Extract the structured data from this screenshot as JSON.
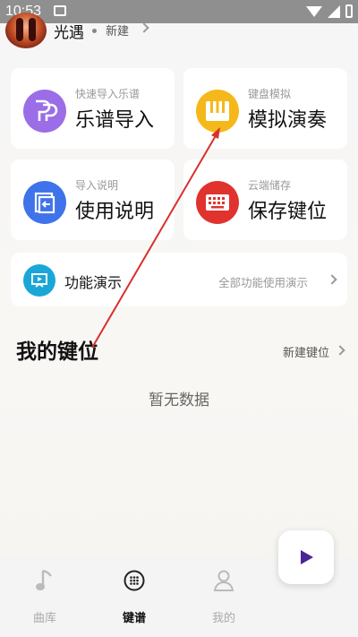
{
  "status_bar": {
    "time": "10:53"
  },
  "header": {
    "app_name": "光遇",
    "new_label": "新建"
  },
  "cards": [
    {
      "subtitle": "快速导入乐谱",
      "title": "乐谱导入",
      "color": "#9b6de6",
      "icon": "import-score-icon"
    },
    {
      "subtitle": "键盘模拟",
      "title": "模拟演奏",
      "color": "#f5b81b",
      "icon": "piano-icon"
    },
    {
      "subtitle": "导入说明",
      "title": "使用说明",
      "color": "#3f73ea",
      "icon": "instructions-icon"
    },
    {
      "subtitle": "云端储存",
      "title": "保存键位",
      "color": "#e0332e",
      "icon": "keyboard-icon"
    }
  ],
  "demo": {
    "title": "功能演示",
    "link": "全部功能使用演示"
  },
  "my_keys": {
    "title": "我的键位",
    "action": "新建键位",
    "empty": "暂无数据"
  },
  "tabs": [
    {
      "label": "曲库",
      "icon": "music-note-icon"
    },
    {
      "label": "键谱",
      "icon": "keypad-icon"
    },
    {
      "label": "我的",
      "icon": "person-icon"
    }
  ],
  "colors": {
    "accent": "#4b2496",
    "annotation_arrow": "#d9302e"
  }
}
